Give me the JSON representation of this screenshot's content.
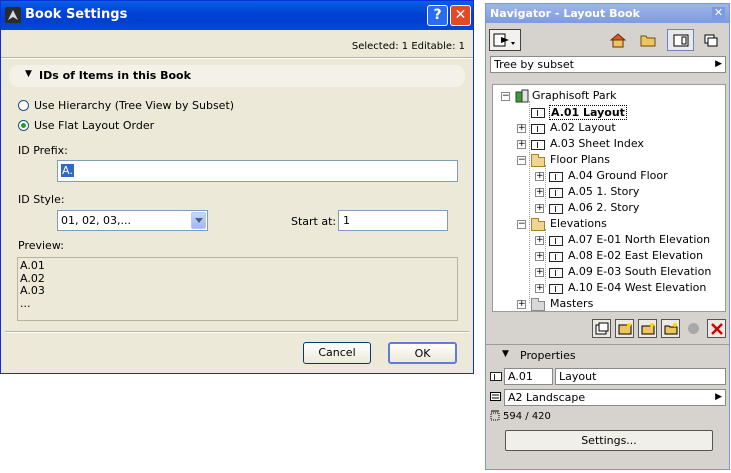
{
  "dialog": {
    "title": "Book Settings",
    "help_label": "?",
    "close_label": "✕",
    "selection_info": "Selected: 1 Editable: 1",
    "section_title": "IDs of Items in this Book",
    "radio_hierarchy": "Use Hierarchy (Tree View by Subset)",
    "radio_flat": "Use Flat Layout Order",
    "radio_selected": "flat",
    "id_prefix_label": "ID Prefix:",
    "id_prefix_value": "A.",
    "id_style_label": "ID Style:",
    "id_style_value": "01, 02, 03,...",
    "start_at_label": "Start at:",
    "start_at_value": "1",
    "preview_label": "Preview:",
    "preview_lines": [
      "A.01",
      "A.02",
      "A.03",
      "..."
    ],
    "cancel_label": "Cancel",
    "ok_label": "OK"
  },
  "navigator": {
    "title": "Navigator - Layout Book",
    "close_label": "✕",
    "view_select": "Tree by subset",
    "tree": {
      "root": "Graphisoft Park",
      "items": [
        {
          "label": "A.01 Layout",
          "selected": true
        },
        {
          "label": "A.02 Layout"
        },
        {
          "label": "A.03 Sheet Index"
        }
      ],
      "floor_plans": {
        "label": "Floor Plans",
        "items": [
          "A.04 Ground Floor",
          "A.05 1. Story",
          "A.06 2. Story"
        ]
      },
      "elevations": {
        "label": "Elevations",
        "items": [
          "A.07 E-01 North Elevation",
          "A.08 E-02 East Elevation",
          "A.09 E-03 South Elevation",
          "A.10 E-04 West Elevation"
        ]
      },
      "masters": "Masters"
    },
    "properties_title": "Properties",
    "prop_id": "A.01",
    "prop_name": "Layout",
    "master_select": "A2 Landscape",
    "size_text": "594 / 420",
    "settings_label": "Settings..."
  }
}
